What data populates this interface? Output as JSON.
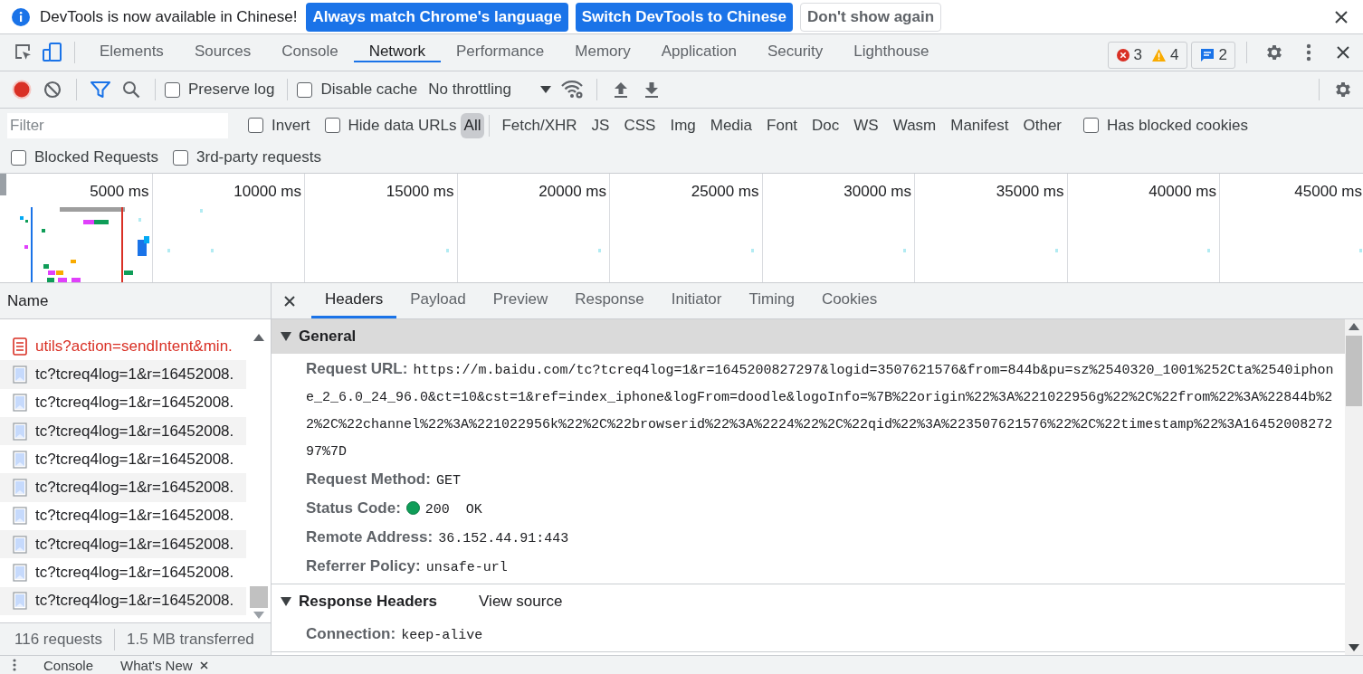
{
  "infobar": {
    "message": "DevTools is now available in Chinese!",
    "buttons": [
      {
        "label": "Always match Chrome's language",
        "kind": "primary"
      },
      {
        "label": "Switch DevTools to Chinese",
        "kind": "primary"
      },
      {
        "label": "Don't show again",
        "kind": "secondary"
      }
    ]
  },
  "panel_tabs": [
    {
      "label": "Elements",
      "selected": false
    },
    {
      "label": "Sources",
      "selected": false
    },
    {
      "label": "Console",
      "selected": false
    },
    {
      "label": "Network",
      "selected": true
    },
    {
      "label": "Performance",
      "selected": false
    },
    {
      "label": "Memory",
      "selected": false
    },
    {
      "label": "Application",
      "selected": false
    },
    {
      "label": "Security",
      "selected": false
    },
    {
      "label": "Lighthouse",
      "selected": false
    }
  ],
  "issue_counts": {
    "errors": "3",
    "warnings": "4",
    "messages": "2"
  },
  "toolbar": {
    "recording": true,
    "preserve_log": {
      "label": "Preserve log",
      "checked": false
    },
    "disable_cache": {
      "label": "Disable cache",
      "checked": false
    },
    "throttling": "No throttling"
  },
  "filter": {
    "placeholder": "Filter",
    "invert": {
      "label": "Invert",
      "checked": false
    },
    "hide_data_urls": {
      "label": "Hide data URLs",
      "checked": false
    },
    "types": [
      {
        "label": "All",
        "selected": true
      },
      {
        "label": "Fetch/XHR",
        "selected": false
      },
      {
        "label": "JS",
        "selected": false
      },
      {
        "label": "CSS",
        "selected": false
      },
      {
        "label": "Img",
        "selected": false
      },
      {
        "label": "Media",
        "selected": false
      },
      {
        "label": "Font",
        "selected": false
      },
      {
        "label": "Doc",
        "selected": false
      },
      {
        "label": "WS",
        "selected": false
      },
      {
        "label": "Wasm",
        "selected": false
      },
      {
        "label": "Manifest",
        "selected": false
      },
      {
        "label": "Other",
        "selected": false
      }
    ],
    "has_blocked_cookies": {
      "label": "Has blocked cookies",
      "checked": false
    },
    "blocked_requests": {
      "label": "Blocked Requests",
      "checked": false
    },
    "third_party": {
      "label": "3rd-party requests",
      "checked": false
    }
  },
  "overview": {
    "ticks": [
      "5000 ms",
      "10000 ms",
      "15000 ms",
      "20000 ms",
      "25000 ms",
      "30000 ms",
      "35000 ms",
      "40000 ms",
      "45000 ms"
    ]
  },
  "requests": {
    "column": "Name",
    "rows": [
      {
        "name": "utils?action=sendIntent&min.",
        "kind": "document",
        "failed": true,
        "selected": false
      },
      {
        "name": "tc?tcreq4log=1&r=16452008.",
        "kind": "image",
        "failed": false,
        "selected": false
      },
      {
        "name": "tc?tcreq4log=1&r=16452008.",
        "kind": "image",
        "failed": false,
        "selected": false
      },
      {
        "name": "tc?tcreq4log=1&r=16452008.",
        "kind": "image",
        "failed": false,
        "selected": false
      },
      {
        "name": "tc?tcreq4log=1&r=16452008.",
        "kind": "image",
        "failed": false,
        "selected": false
      },
      {
        "name": "tc?tcreq4log=1&r=16452008.",
        "kind": "image",
        "failed": false,
        "selected": false
      },
      {
        "name": "tc?tcreq4log=1&r=16452008.",
        "kind": "image",
        "failed": false,
        "selected": false
      },
      {
        "name": "tc?tcreq4log=1&r=16452008.",
        "kind": "image",
        "failed": false,
        "selected": false
      },
      {
        "name": "tc?tcreq4log=1&r=16452008.",
        "kind": "image",
        "failed": false,
        "selected": false
      },
      {
        "name": "tc?tcreq4log=1&r=16452008.",
        "kind": "image",
        "failed": false,
        "selected": false
      }
    ]
  },
  "status_bar": {
    "requests": "116 requests",
    "transferred": "1.5 MB transferred"
  },
  "details": {
    "tabs": [
      {
        "label": "Headers",
        "selected": true
      },
      {
        "label": "Payload",
        "selected": false
      },
      {
        "label": "Preview",
        "selected": false
      },
      {
        "label": "Response",
        "selected": false
      },
      {
        "label": "Initiator",
        "selected": false
      },
      {
        "label": "Timing",
        "selected": false
      },
      {
        "label": "Cookies",
        "selected": false
      }
    ],
    "sections": [
      {
        "title": "General",
        "expanded": true,
        "highlighted": true,
        "fields": [
          {
            "name": "Request URL:",
            "value": "https://m.baidu.com/tc?tcreq4log=1&r=1645200827297&logid=3507621576&from=844b&pu=sz%2540320_1001%252Cta%2540iphone_2_6.0_24_96.0&ct=10&cst=1&ref=index_iphone&logFrom=doodle&logoInfo=%7B%22origin%22%3A%221022956g%22%2C%22from%22%3A%22844b%22%2C%22channel%22%3A%221022956k%22%2C%22browserid%22%3A%2224%22%2C%22qid%22%3A%223507621576%22%2C%22timestamp%22%3A1645200827297%7D",
            "kind": "wrapped"
          },
          {
            "name": "Request Method:",
            "value": "GET",
            "kind": "text"
          },
          {
            "name": "Status Code:",
            "value": "200  OK",
            "kind": "status"
          },
          {
            "name": "Remote Address:",
            "value": "36.152.44.91:443",
            "kind": "text"
          },
          {
            "name": "Referrer Policy:",
            "value": "unsafe-url",
            "kind": "text"
          }
        ]
      },
      {
        "title": "Response Headers",
        "expanded": true,
        "highlighted": false,
        "action": "View source",
        "fields": [
          {
            "name": "Connection:",
            "value": "keep-alive",
            "kind": "text"
          }
        ]
      }
    ]
  },
  "drawer": {
    "tabs": [
      {
        "label": "Console",
        "closable": false
      },
      {
        "label": "What's New",
        "closable": true
      }
    ]
  }
}
